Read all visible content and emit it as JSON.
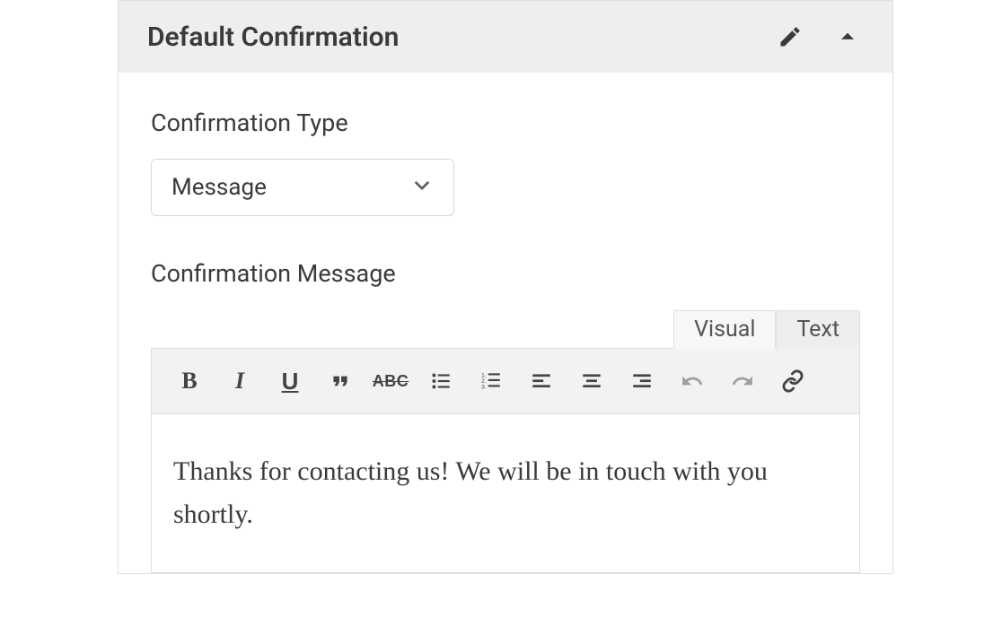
{
  "panel": {
    "title": "Default Confirmation"
  },
  "fields": {
    "type_label": "Confirmation Type",
    "type_value": "Message",
    "message_label": "Confirmation Message"
  },
  "editor": {
    "tabs": {
      "visual": "Visual",
      "text": "Text"
    },
    "content": "Thanks for contacting us! We will be in touch with you shortly.",
    "toolbar": {
      "strike_label": "ABC"
    }
  }
}
